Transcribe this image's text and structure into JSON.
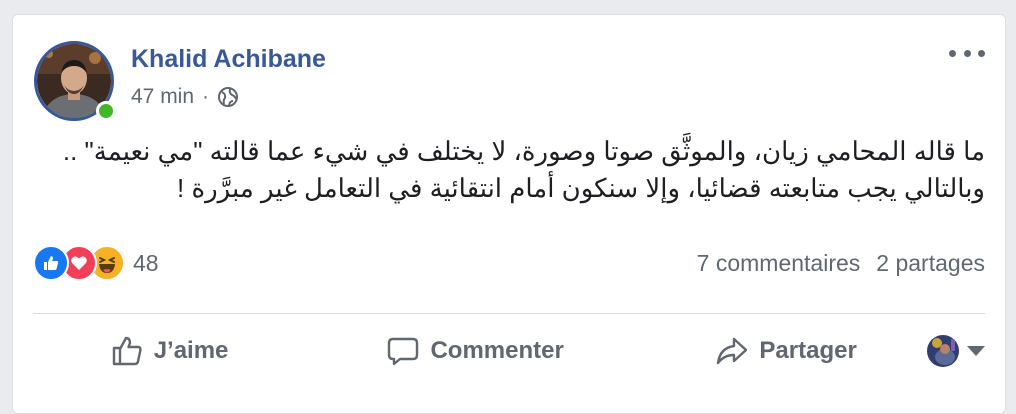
{
  "post": {
    "author": "Khalid Achibane",
    "time": "47 min",
    "separator": "·",
    "privacy_icon": "globe-icon",
    "text": "ما قاله المحامي زيان، والموثَّق صوتا وصورة، لا يختلف في شيء عما قالته \"مي نعيمة\" .. وبالتالي يجب متابعته قضائيا، وإلا سنكون أمام انتقائية في التعامل غير مبرَّرة !"
  },
  "stats": {
    "reactions": [
      "like",
      "love",
      "haha"
    ],
    "reaction_count": "48",
    "comments": "7 commentaires",
    "shares": "2 partages"
  },
  "actions": {
    "like_label": "J’aime",
    "comment_label": "Commenter",
    "share_label": "Partager"
  },
  "colors": {
    "author": "#385898",
    "like": "#1877f2",
    "love": "#f33e58",
    "haha": "#f7b125",
    "online": "#42b72a"
  }
}
